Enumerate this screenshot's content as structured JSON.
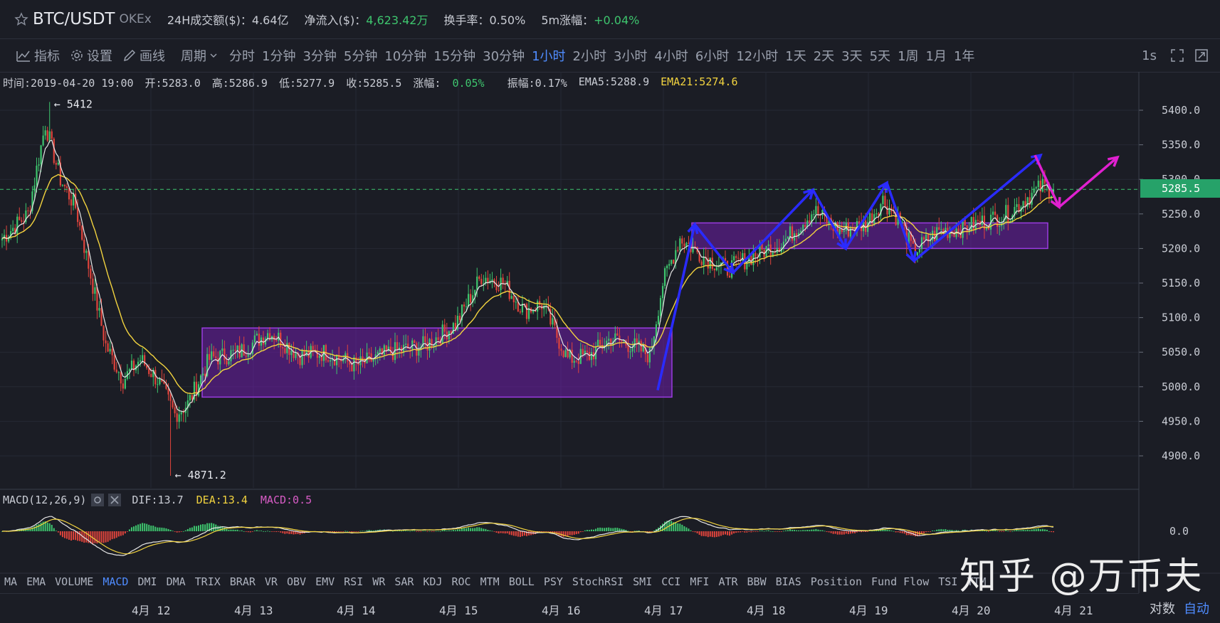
{
  "header": {
    "pair": "BTC/USDT",
    "exchange": "OKEx",
    "stats": [
      {
        "label": "24H成交额($)：",
        "value": "4.64亿"
      },
      {
        "label": "净流入($)：",
        "value": "4,623.42万"
      },
      {
        "label": "换手率：",
        "value": "0.50%"
      },
      {
        "label": "5m涨幅：",
        "value": "+0.04%"
      }
    ]
  },
  "toolbar": {
    "indicator_label": "指标",
    "settings_label": "设置",
    "draw_label": "画线",
    "period_label": "周期",
    "intervals": [
      "分时",
      "1分钟",
      "3分钟",
      "5分钟",
      "10分钟",
      "15分钟",
      "30分钟",
      "1小时",
      "2小时",
      "3小时",
      "4小时",
      "6小时",
      "12小时",
      "1天",
      "2天",
      "3天",
      "5天",
      "1周",
      "1月",
      "1年"
    ],
    "active_interval": "1小时",
    "right_label": "1s"
  },
  "ohlc": {
    "time": "时间:2019-04-20 19:00",
    "open": "开:5283.0",
    "high": "高:5286.9",
    "low": "低:5277.9",
    "close": "收:5285.5",
    "change_label": "涨幅:",
    "change_value": "0.05%",
    "amplitude": "振幅:0.17%",
    "ema5": "EMA5:5288.9",
    "ema21": "EMA21:5274.6"
  },
  "macd_info": {
    "name": "MACD(12,26,9)",
    "dif": "DIF:13.7",
    "dea": "DEA:13.4",
    "macd": "MACD:0.5",
    "zero_label": "0.0"
  },
  "indicators": [
    "MA",
    "EMA",
    "VOLUME",
    "MACD",
    "DMI",
    "DMA",
    "TRIX",
    "BRAR",
    "VR",
    "OBV",
    "EMV",
    "RSI",
    "WR",
    "SAR",
    "KDJ",
    "ROC",
    "MTM",
    "BOLL",
    "PSY",
    "StochRSI",
    "SMI",
    "CCI",
    "MFI",
    "ATR",
    "BBW",
    "BIAS",
    "Position",
    "Fund Flow",
    "TSI",
    "TTM"
  ],
  "active_indicator": "MACD",
  "price_axis": [
    "5400.0",
    "5350.0",
    "5300.0",
    "5250.0",
    "5200.0",
    "5150.0",
    "5100.0",
    "5050.0",
    "5000.0",
    "4950.0",
    "4900.0"
  ],
  "current_price": "5285.5",
  "max_marker": "← 5412",
  "min_marker": "← 4871.2",
  "dates": [
    "4月 12",
    "4月 13",
    "4月 14",
    "4月 15",
    "4月 16",
    "4月 17",
    "4月 18",
    "4月 19",
    "4月 20",
    "4月 21"
  ],
  "corner": {
    "log": "对数",
    "auto": "自动"
  },
  "watermark": "知乎 @万币夫",
  "colors": {
    "up": "#3ec56e",
    "down": "#e0443c",
    "ema5": "#e6e6e6",
    "ema21": "#f2d33f",
    "active": "#4f8cff",
    "box": "#7a1fb0",
    "arrow_blue": "#2a2bff",
    "arrow_pink": "#e020d0"
  },
  "chart_data": {
    "type": "candlestick",
    "title": "",
    "x_start": "2019-04-11 19:00",
    "interval": "1h",
    "ylim": [
      4850,
      5430
    ],
    "anchors": [
      [
        0,
        5215
      ],
      [
        12,
        5250
      ],
      [
        20,
        5380
      ],
      [
        27,
        5300
      ],
      [
        34,
        5260
      ],
      [
        40,
        5175
      ],
      [
        48,
        5060
      ],
      [
        56,
        5010
      ],
      [
        64,
        5040
      ],
      [
        72,
        5010
      ],
      [
        80,
        4960
      ],
      [
        86,
        4975
      ],
      [
        96,
        5040
      ],
      [
        110,
        5050
      ],
      [
        124,
        5080
      ],
      [
        138,
        5045
      ],
      [
        150,
        5050
      ],
      [
        164,
        5030
      ],
      [
        180,
        5050
      ],
      [
        196,
        5060
      ],
      [
        210,
        5090
      ],
      [
        222,
        5160
      ],
      [
        232,
        5150
      ],
      [
        242,
        5110
      ],
      [
        250,
        5120
      ],
      [
        256,
        5080
      ],
      [
        262,
        5040
      ],
      [
        272,
        5045
      ],
      [
        282,
        5070
      ],
      [
        292,
        5060
      ],
      [
        300,
        5045
      ],
      [
        306,
        5150
      ],
      [
        314,
        5215
      ],
      [
        324,
        5190
      ],
      [
        336,
        5170
      ],
      [
        348,
        5190
      ],
      [
        362,
        5210
      ],
      [
        376,
        5255
      ],
      [
        388,
        5225
      ],
      [
        400,
        5235
      ],
      [
        408,
        5270
      ],
      [
        416,
        5240
      ],
      [
        422,
        5195
      ],
      [
        434,
        5225
      ],
      [
        446,
        5230
      ],
      [
        456,
        5240
      ],
      [
        466,
        5250
      ],
      [
        474,
        5272
      ],
      [
        482,
        5290
      ],
      [
        487,
        5285.5
      ]
    ],
    "max_value": 5412,
    "min_value": 4871.2,
    "last_close": 5285.5
  }
}
